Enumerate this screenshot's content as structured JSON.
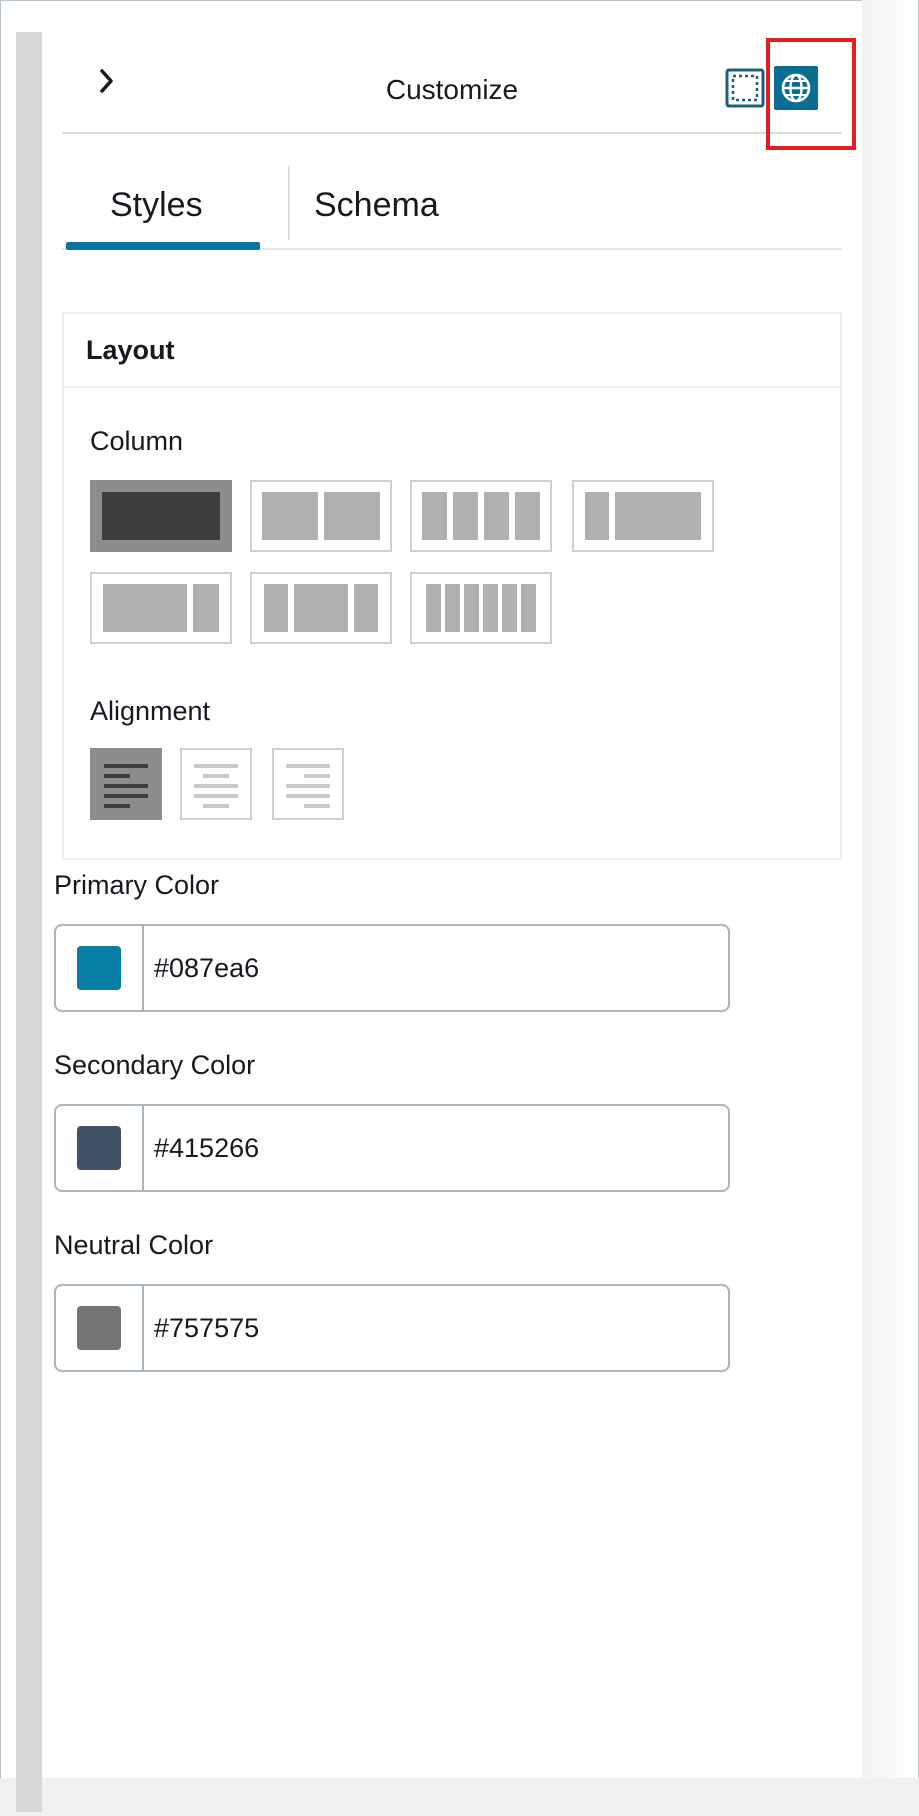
{
  "panel": {
    "title": "Customize",
    "tabs": [
      {
        "label": "Styles",
        "active": true
      },
      {
        "label": "Schema",
        "active": false
      }
    ]
  },
  "layout": {
    "heading": "Layout",
    "column_label": "Column",
    "column_selected_index": 0,
    "alignment_label": "Alignment",
    "alignment_options": [
      "left",
      "center",
      "right"
    ],
    "alignment_selected": "left"
  },
  "colors": {
    "primary": {
      "label": "Primary Color",
      "value": "#087ea6",
      "swatch": "#087ea6"
    },
    "secondary": {
      "label": "Secondary Color",
      "value": "#415266",
      "swatch": "#415266"
    },
    "neutral": {
      "label": "Neutral Color",
      "value": "#757575",
      "swatch": "#757575"
    }
  },
  "icons": [
    "chevron-right-icon",
    "dotted-frame-icon",
    "globe-icon"
  ],
  "accent": "#0a74a0",
  "highlight_color": "#e01f23"
}
